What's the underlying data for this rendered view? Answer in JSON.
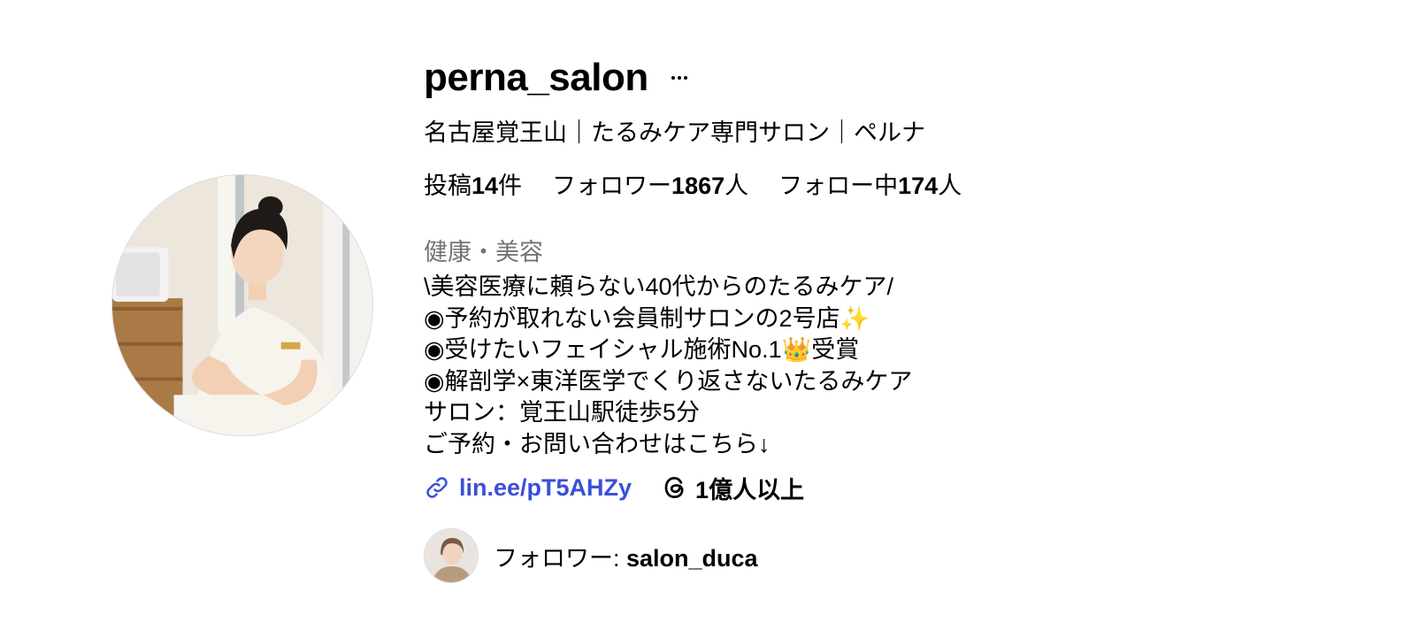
{
  "profile": {
    "username": "perna_salon",
    "full_name": "名古屋覚王山｜たるみケア専門サロン｜ペルナ",
    "category": "健康・美容",
    "avatar_icon": "profile-photo-facial-treatment"
  },
  "stats": {
    "posts_prefix": "投稿",
    "posts_count": "14",
    "posts_suffix": "件",
    "followers_prefix": "フォロワー",
    "followers_count": "1867",
    "followers_suffix": "人",
    "following_prefix": "フォロー中",
    "following_count": "174",
    "following_suffix": "人"
  },
  "bio": {
    "line1": "\\美容医療に頼らない40代からのたるみケア/",
    "line2_text": "◉予約が取れない会員制サロンの2号店",
    "line2_emoji": "✨",
    "line3_before": "◉受けたいフェイシャル施術No.1",
    "line3_emoji": "👑",
    "line3_after": "受賞",
    "line4": "◉解剖学×東洋医学でくり返さないたるみケア",
    "line5": "サロン：覚王山駅徒歩5分",
    "line6": "ご予約・お問い合わせはこちら↓"
  },
  "links": {
    "url_label": "lin.ee/pT5AHZy",
    "threads_label": "1億人以上",
    "link_color": "#3a4fd9"
  },
  "followed_by": {
    "prefix": "フォロワー: ",
    "username": "salon_duca"
  }
}
